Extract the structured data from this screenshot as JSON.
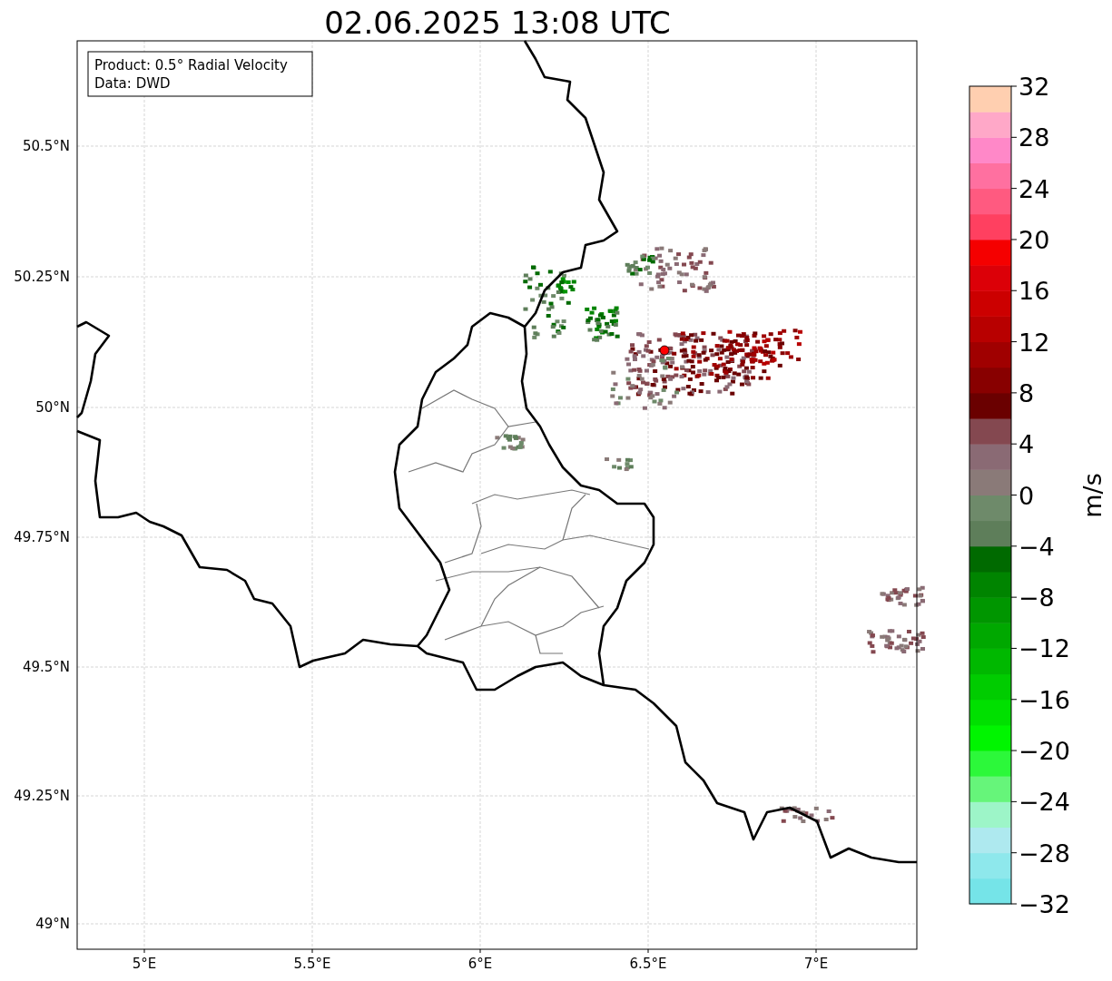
{
  "title": "02.06.2025 13:08 UTC",
  "info_box": [
    "Product: 0.5° Radial Velocity",
    "Data: DWD"
  ],
  "map": {
    "x_ticks": [
      "5°E",
      "5.5°E",
      "6°E",
      "6.5°E",
      "7°E"
    ],
    "y_ticks": [
      "50.5°N",
      "50.25°N",
      "50°N",
      "49.75°N",
      "49.5°N",
      "49.25°N",
      "49°N"
    ]
  },
  "colorbar": {
    "label": "m/s",
    "ticks": [
      "32",
      "28",
      "24",
      "20",
      "16",
      "12",
      "8",
      "4",
      "0",
      "−4",
      "−8",
      "−12",
      "−16",
      "−20",
      "−24",
      "−28",
      "−32"
    ],
    "bins": [
      {
        "color": "#75e4e8"
      },
      {
        "color": "#8ee8ec"
      },
      {
        "color": "#aee9ef"
      },
      {
        "color": "#9df5c8"
      },
      {
        "color": "#66f57a"
      },
      {
        "color": "#2cf83a"
      },
      {
        "color": "#00f500"
      },
      {
        "color": "#00e000"
      },
      {
        "color": "#00cc00"
      },
      {
        "color": "#00b800"
      },
      {
        "color": "#00a800"
      },
      {
        "color": "#009600"
      },
      {
        "color": "#008400"
      },
      {
        "color": "#006a00"
      },
      {
        "color": "#5e7e5a"
      },
      {
        "color": "#6e8a6a"
      },
      {
        "color": "#8a7a78"
      },
      {
        "color": "#8a6a74"
      },
      {
        "color": "#844850"
      },
      {
        "color": "#6a0000"
      },
      {
        "color": "#880000"
      },
      {
        "color": "#a00000"
      },
      {
        "color": "#b80000"
      },
      {
        "color": "#cc0000"
      },
      {
        "color": "#dc0008"
      },
      {
        "color": "#f50000"
      },
      {
        "color": "#ff4060"
      },
      {
        "color": "#ff5a80"
      },
      {
        "color": "#ff70a0"
      },
      {
        "color": "#ff88c8"
      },
      {
        "color": "#ffa8c8"
      },
      {
        "color": "#ffcfb0"
      }
    ]
  }
}
